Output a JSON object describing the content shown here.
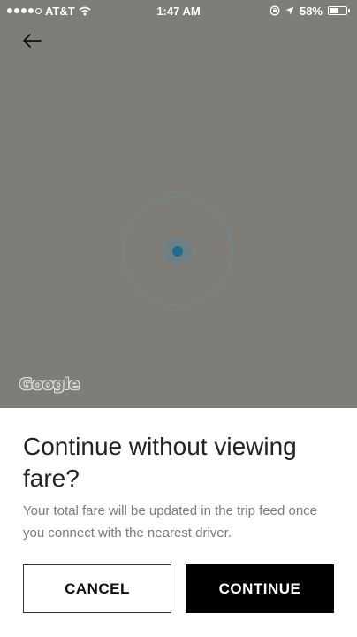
{
  "status_bar": {
    "carrier": "AT&T",
    "time": "1:47 AM",
    "battery_percent": "58%",
    "battery_level": 0.58,
    "signal_icon": "signal-dots-icon",
    "wifi_icon": "wifi-icon",
    "lock_icon": "orientation-lock-icon",
    "location_icon": "location-arrow-icon"
  },
  "map": {
    "back_icon": "arrow-left-icon",
    "attribution": "Google",
    "background_color": "#7f7d77",
    "location_color": "#1e6d8f"
  },
  "dialog": {
    "title": "Continue without viewing fare?",
    "message": "Your total fare will be updated in the trip feed once you connect with the nearest driver.",
    "cancel_label": "CANCEL",
    "continue_label": "CONTINUE"
  }
}
